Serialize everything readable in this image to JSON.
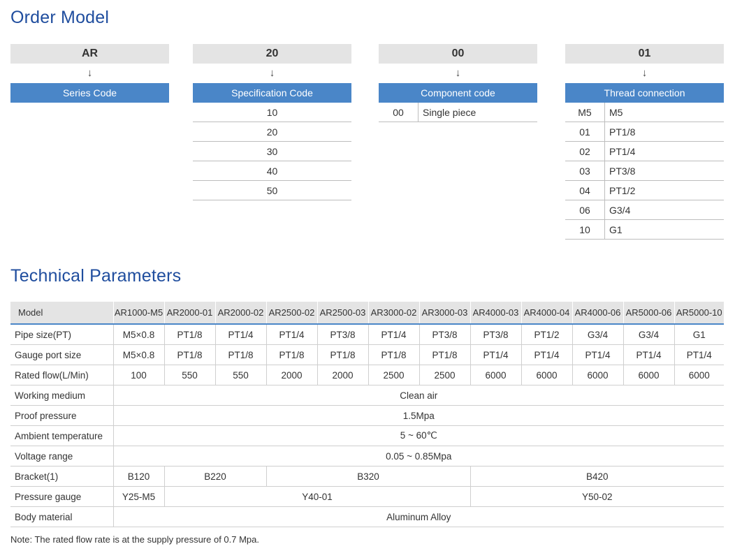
{
  "order_model": {
    "title": "Order Model",
    "arrow": "↓",
    "columns": [
      {
        "code": "AR",
        "header": "Series Code",
        "rows": []
      },
      {
        "code": "20",
        "header": "Specification Code",
        "rows": [
          "10",
          "20",
          "30",
          "40",
          "50"
        ]
      },
      {
        "code": "00",
        "header": "Component code",
        "rows": [
          {
            "k": "00",
            "v": "Single piece"
          }
        ]
      },
      {
        "code": "01",
        "header": "Thread connection",
        "rows": [
          {
            "k": "M5",
            "v": "M5"
          },
          {
            "k": "01",
            "v": "PT1/8"
          },
          {
            "k": "02",
            "v": "PT1/4"
          },
          {
            "k": "03",
            "v": "PT3/8"
          },
          {
            "k": "04",
            "v": "PT1/2"
          },
          {
            "k": "06",
            "v": "G3/4"
          },
          {
            "k": "10",
            "v": "G1"
          }
        ]
      }
    ]
  },
  "technical": {
    "title": "Technical Parameters",
    "header_label": "Model",
    "models": [
      "AR1000-M5",
      "AR2000-01",
      "AR2000-02",
      "AR2500-02",
      "AR2500-03",
      "AR3000-02",
      "AR3000-03",
      "AR4000-03",
      "AR4000-04",
      "AR4000-06",
      "AR5000-06",
      "AR5000-10"
    ],
    "rows": [
      {
        "label": "Pipe size(PT)",
        "cells": [
          {
            "text": "M5×0.8",
            "span": 1
          },
          {
            "text": "PT1/8",
            "span": 1
          },
          {
            "text": "PT1/4",
            "span": 1
          },
          {
            "text": "PT1/4",
            "span": 1
          },
          {
            "text": "PT3/8",
            "span": 1
          },
          {
            "text": "PT1/4",
            "span": 1
          },
          {
            "text": "PT3/8",
            "span": 1
          },
          {
            "text": "PT3/8",
            "span": 1
          },
          {
            "text": "PT1/2",
            "span": 1
          },
          {
            "text": "G3/4",
            "span": 1
          },
          {
            "text": "G3/4",
            "span": 1
          },
          {
            "text": "G1",
            "span": 1
          }
        ]
      },
      {
        "label": "Gauge port size",
        "cells": [
          {
            "text": "M5×0.8",
            "span": 1
          },
          {
            "text": "PT1/8",
            "span": 1
          },
          {
            "text": "PT1/8",
            "span": 1
          },
          {
            "text": "PT1/8",
            "span": 1
          },
          {
            "text": "PT1/8",
            "span": 1
          },
          {
            "text": "PT1/8",
            "span": 1
          },
          {
            "text": "PT1/8",
            "span": 1
          },
          {
            "text": "PT1/4",
            "span": 1
          },
          {
            "text": "PT1/4",
            "span": 1
          },
          {
            "text": "PT1/4",
            "span": 1
          },
          {
            "text": "PT1/4",
            "span": 1
          },
          {
            "text": "PT1/4",
            "span": 1
          }
        ]
      },
      {
        "label": "Rated flow(L/Min)",
        "cells": [
          {
            "text": "100",
            "span": 1
          },
          {
            "text": "550",
            "span": 1
          },
          {
            "text": "550",
            "span": 1
          },
          {
            "text": "2000",
            "span": 1
          },
          {
            "text": "2000",
            "span": 1
          },
          {
            "text": "2500",
            "span": 1
          },
          {
            "text": "2500",
            "span": 1
          },
          {
            "text": "6000",
            "span": 1
          },
          {
            "text": "6000",
            "span": 1
          },
          {
            "text": "6000",
            "span": 1
          },
          {
            "text": "6000",
            "span": 1
          },
          {
            "text": "6000",
            "span": 1
          }
        ]
      },
      {
        "label": "Working medium",
        "cells": [
          {
            "text": "Clean air",
            "span": 12
          }
        ]
      },
      {
        "label": "Proof pressure",
        "cells": [
          {
            "text": "1.5Mpa",
            "span": 12
          }
        ]
      },
      {
        "label": "Ambient temperature",
        "cells": [
          {
            "text": "5 ~ 60℃",
            "span": 12
          }
        ]
      },
      {
        "label": "Voltage range",
        "cells": [
          {
            "text": "0.05 ~ 0.85Mpa",
            "span": 12
          }
        ]
      },
      {
        "label": "Bracket(1)",
        "cells": [
          {
            "text": "B120",
            "span": 1
          },
          {
            "text": "B220",
            "span": 2
          },
          {
            "text": "B320",
            "span": 4
          },
          {
            "text": "B420",
            "span": 5
          }
        ]
      },
      {
        "label": "Pressure gauge",
        "cells": [
          {
            "text": "Y25-M5",
            "span": 1
          },
          {
            "text": "Y40-01",
            "span": 6
          },
          {
            "text": "Y50-02",
            "span": 5
          }
        ]
      },
      {
        "label": "Body material",
        "cells": [
          {
            "text": "Aluminum Alloy",
            "span": 12
          }
        ]
      }
    ]
  },
  "note": "Note: The rated flow rate is at the supply pressure of 0.7 Mpa.",
  "colors": {
    "accent": "#4a86c8",
    "title": "#1f4d9e",
    "code_bg": "#e4e4e4"
  }
}
